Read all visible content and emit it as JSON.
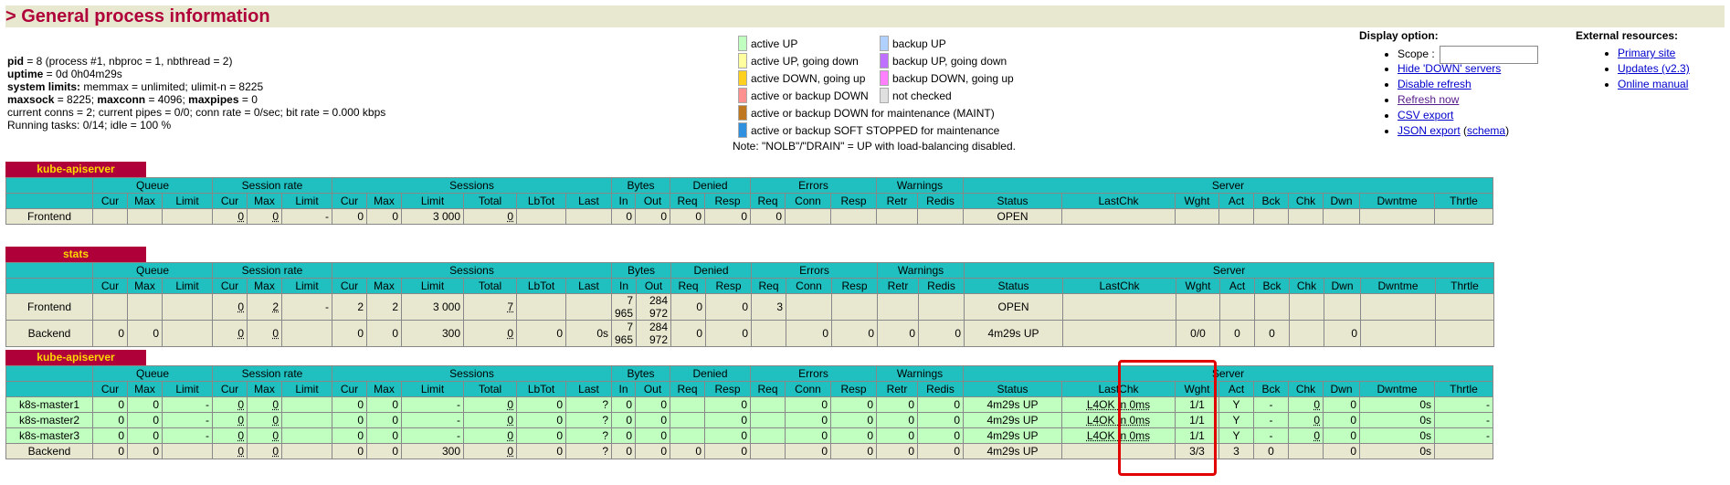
{
  "page": {
    "title": "> General process information"
  },
  "info": {
    "pid_label": "pid",
    "pid_value": " = 8 (process #1, nbproc = 1, nbthread = 2)",
    "uptime_label": "uptime",
    "uptime_value": " = 0d 0h04m29s",
    "syslimits_label": "system limits:",
    "syslimits_value": " memmax = unlimited; ulimit-n = 8225",
    "maxsock_label": "maxsock",
    "maxsock_value": " = 8225; ",
    "maxconn_label": "maxconn",
    "maxconn_value": " = 4096; ",
    "maxpipes_label": "maxpipes",
    "maxpipes_value": " = 0",
    "conns_line": "current conns = 2; current pipes = 0/0; conn rate = 0/sec; bit rate = 0.000 kbps",
    "tasks_line": "Running tasks: 0/14; idle = 100 %"
  },
  "legend": {
    "col1": [
      {
        "label": "active UP",
        "color": "#c0ffc0"
      },
      {
        "label": "active UP, going down",
        "color": "#ffffa0"
      },
      {
        "label": "active DOWN, going up",
        "color": "#ffd020"
      },
      {
        "label": "active or backup DOWN",
        "color": "#ff9090"
      },
      {
        "label": "active or backup DOWN for maintenance (MAINT)",
        "color": "#c07820"
      },
      {
        "label": "active or backup SOFT STOPPED for maintenance",
        "color": "#3090e0"
      }
    ],
    "col2": [
      {
        "label": "backup UP",
        "color": "#b0d0ff"
      },
      {
        "label": "backup UP, going down",
        "color": "#c070ff"
      },
      {
        "label": "backup DOWN, going up",
        "color": "#ff80ff"
      },
      {
        "label": "not checked",
        "color": "#e0e0e0"
      }
    ],
    "note": "Note: \"NOLB\"/\"DRAIN\" = UP with load-balancing disabled."
  },
  "display": {
    "heading": "Display option:",
    "scope_label": "Scope : ",
    "links": [
      "Hide 'DOWN' servers",
      "Disable refresh",
      "Refresh now",
      "CSV export",
      "JSON export"
    ],
    "schema_open": " (",
    "schema_link": "schema",
    "schema_close": ")"
  },
  "external": {
    "heading": "External resources:",
    "links": [
      "Primary site",
      "Updates (v2.3)",
      "Online manual"
    ]
  },
  "headers": {
    "groups": [
      "Queue",
      "Session rate",
      "Sessions",
      "Bytes",
      "Denied",
      "Errors",
      "Warnings",
      "Server"
    ],
    "cols": [
      "Cur",
      "Max",
      "Limit",
      "Cur",
      "Max",
      "Limit",
      "Cur",
      "Max",
      "Limit",
      "Total",
      "LbTot",
      "Last",
      "In",
      "Out",
      "Req",
      "Resp",
      "Req",
      "Conn",
      "Resp",
      "Retr",
      "Redis",
      "Status",
      "LastChk",
      "Wght",
      "Act",
      "Bck",
      "Chk",
      "Dwn",
      "Dwntme",
      "Thrtle"
    ]
  },
  "sections": [
    {
      "name": "kube-apiserver",
      "rows": [
        {
          "name": "Frontend",
          "cells": [
            "",
            "",
            "",
            "0",
            "0",
            "-",
            "0",
            "0",
            "3 000",
            "0",
            "",
            "",
            "0",
            "0",
            "0",
            "0",
            "0",
            "",
            "",
            "",
            "",
            "OPEN",
            "",
            "",
            "",
            "",
            "",
            "",
            "",
            ""
          ]
        }
      ]
    },
    {
      "name": "stats",
      "rows": [
        {
          "name": "Frontend",
          "cells": [
            "",
            "",
            "",
            "0",
            "2",
            "-",
            "2",
            "2",
            "3 000",
            "7",
            "",
            "",
            "7 965",
            "284 972",
            "0",
            "0",
            "3",
            "",
            "",
            "",
            "",
            "OPEN",
            "",
            "",
            "",
            "",
            "",
            "",
            "",
            ""
          ]
        },
        {
          "name": "Backend",
          "cells": [
            "0",
            "0",
            "",
            "0",
            "0",
            "",
            "0",
            "0",
            "300",
            "0",
            "0",
            "0s",
            "7 965",
            "284 972",
            "0",
            "0",
            "",
            "0",
            "0",
            "0",
            "0",
            "4m29s UP",
            "",
            "0/0",
            "0",
            "0",
            "",
            "0",
            "",
            ""
          ]
        }
      ]
    },
    {
      "name": "kube-apiserver",
      "rows": [
        {
          "name": "k8s-master1",
          "cells": [
            "0",
            "0",
            "-",
            "0",
            "0",
            "",
            "0",
            "0",
            "-",
            "0",
            "0",
            "?",
            "0",
            "0",
            "",
            "0",
            "",
            "0",
            "0",
            "0",
            "0",
            "4m29s UP",
            "L4OK in 0ms",
            "1/1",
            "Y",
            "-",
            "0",
            "0",
            "0s",
            "-"
          ]
        },
        {
          "name": "k8s-master2",
          "cells": [
            "0",
            "0",
            "-",
            "0",
            "0",
            "",
            "0",
            "0",
            "-",
            "0",
            "0",
            "?",
            "0",
            "0",
            "",
            "0",
            "",
            "0",
            "0",
            "0",
            "0",
            "4m29s UP",
            "L4OK in 0ms",
            "1/1",
            "Y",
            "-",
            "0",
            "0",
            "0s",
            "-"
          ]
        },
        {
          "name": "k8s-master3",
          "cells": [
            "0",
            "0",
            "-",
            "0",
            "0",
            "",
            "0",
            "0",
            "-",
            "0",
            "0",
            "?",
            "0",
            "0",
            "",
            "0",
            "",
            "0",
            "0",
            "0",
            "0",
            "4m29s UP",
            "L4OK in 0ms",
            "1/1",
            "Y",
            "-",
            "0",
            "0",
            "0s",
            "-"
          ]
        },
        {
          "name": "Backend",
          "cells": [
            "0",
            "0",
            "",
            "0",
            "0",
            "",
            "0",
            "0",
            "300",
            "0",
            "0",
            "?",
            "0",
            "0",
            "0",
            "0",
            "",
            "0",
            "0",
            "0",
            "0",
            "4m29s UP",
            "",
            "3/3",
            "3",
            "0",
            "",
            "0",
            "0s",
            ""
          ]
        }
      ]
    }
  ]
}
